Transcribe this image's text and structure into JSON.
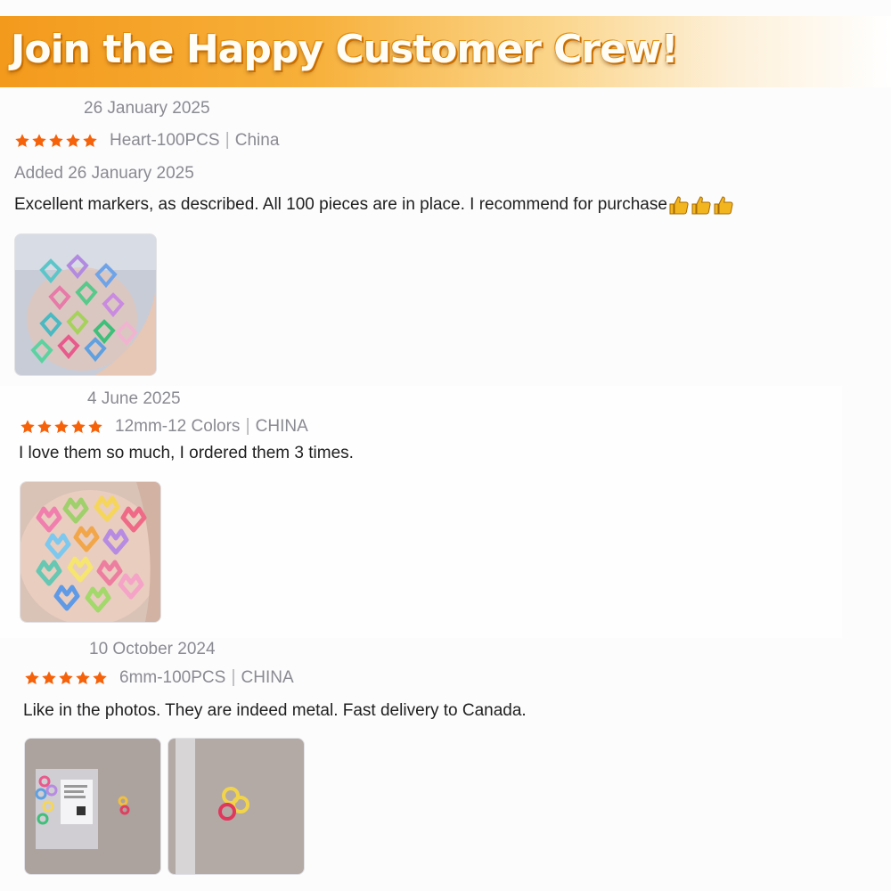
{
  "banner": {
    "title": "Join the Happy Customer Crew!"
  },
  "colors": {
    "star": "#f5620a",
    "banner_start": "#f39a1c",
    "muted_text": "#8a8a92"
  },
  "reviews": [
    {
      "date": "26 January 2025",
      "rating": 5,
      "variant": "Heart-100PCS",
      "separator": "|",
      "origin": "China",
      "added": "Added 26 January 2025",
      "text": "Excellent markers, as described. All 100 pieces are in place. I recommend for purchase",
      "emoji": [
        "thumbs-up-icon",
        "thumbs-up-icon",
        "thumbs-up-icon"
      ],
      "photos": [
        "photo-heart-markers-in-hand"
      ]
    },
    {
      "date": "4 June 2025",
      "rating": 5,
      "variant": "12mm-12 Colors",
      "separator": "|",
      "origin": "CHINA",
      "text": "I love them so much, I ordered them 3 times.",
      "photos": [
        "photo-cat-markers-in-hand"
      ]
    },
    {
      "date": "10 October 2024",
      "rating": 5,
      "variant": "6mm-100PCS",
      "separator": "|",
      "origin": "CHINA",
      "text": "Like in the photos. They are indeed metal. Fast delivery to Canada.",
      "photos": [
        "photo-package-on-table",
        "photo-rings-on-table"
      ]
    }
  ]
}
